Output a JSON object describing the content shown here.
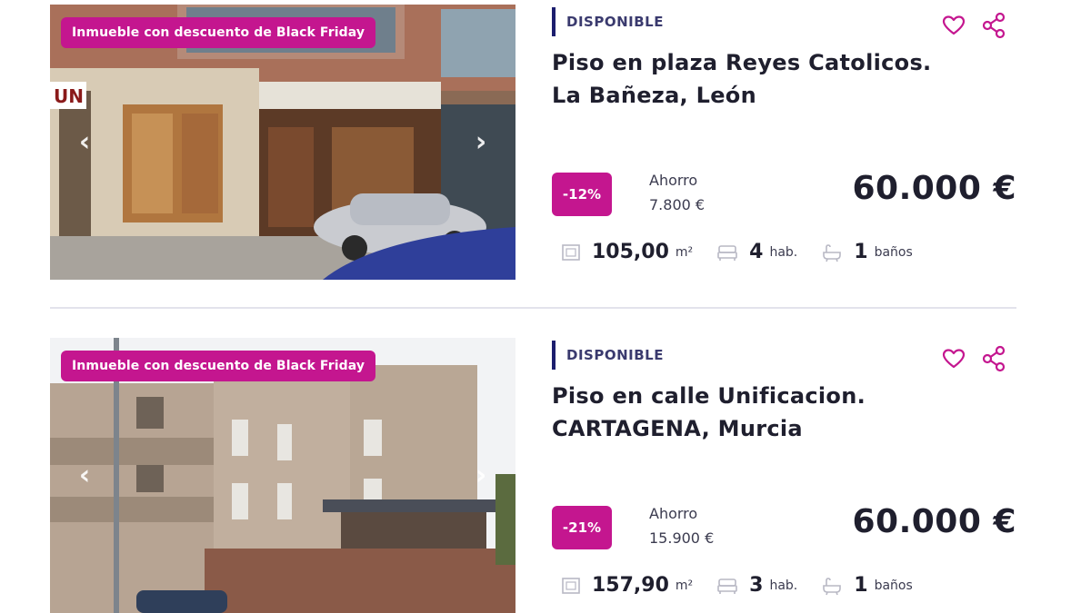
{
  "listings": [
    {
      "badge": "Inmueble con descuento de Black Friday",
      "status": "DISPONIBLE",
      "title_line1": "Piso en plaza Reyes Catolicos.",
      "title_line2": "La Bañeza, León",
      "discount": "-12%",
      "savings_label": "Ahorro",
      "savings_value": "7.800 €",
      "price": "60.000 €",
      "area": "105,00",
      "area_unit": "m²",
      "rooms": "4",
      "rooms_unit": "hab.",
      "baths": "1",
      "baths_unit": "baños",
      "photo_sign": "UN"
    },
    {
      "badge": "Inmueble con descuento de Black Friday",
      "status": "DISPONIBLE",
      "title_line1": "Piso en calle Unificacion.",
      "title_line2": "CARTAGENA, Murcia",
      "discount": "-21%",
      "savings_label": "Ahorro",
      "savings_value": "15.900 €",
      "price": "60.000 €",
      "area": "157,90",
      "area_unit": "m²",
      "rooms": "3",
      "rooms_unit": "hab.",
      "baths": "1",
      "baths_unit": "baños"
    }
  ],
  "colors": {
    "accent": "#c4168f",
    "status_bar": "#1c1e6e",
    "text": "#1f1f2e"
  },
  "icons": [
    "heart-icon",
    "share-icon",
    "area-icon",
    "bed-icon",
    "bath-icon",
    "chevron-left-icon",
    "chevron-right-icon"
  ]
}
